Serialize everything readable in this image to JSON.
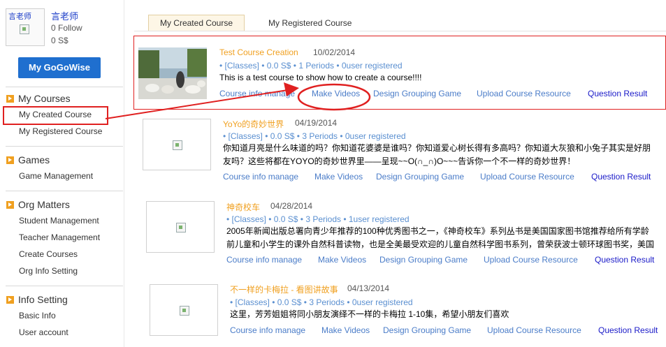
{
  "user": {
    "avatar_caption": "言老师",
    "name": "言老师",
    "follow": "0 Follow",
    "balance": "0 S$"
  },
  "gogowise_button": "My GoGoWise",
  "sidebar": {
    "sections": [
      {
        "title": "My Courses",
        "items": [
          "My Created Course",
          "My Registered Course"
        ]
      },
      {
        "title": "Games",
        "items": [
          "Game Management"
        ]
      },
      {
        "title": "Org Matters",
        "items": [
          "Student Management",
          "Teacher Management",
          "Create Courses",
          "Org Info Setting"
        ]
      },
      {
        "title": "Info Setting",
        "items": [
          "Basic Info",
          "User account"
        ]
      }
    ]
  },
  "tabs": [
    "My Created Course",
    "My Registered Course"
  ],
  "actions": [
    "Course info manage",
    "Make Videos",
    "Design Grouping Game",
    "Upload Course Resource",
    "Question Result"
  ],
  "courses": [
    {
      "title": "Test Course Creation",
      "date": "10/02/2014",
      "meta": "• [Classes] • 0.0 S$ • 1 Periods • 0user registered",
      "desc": [
        "This is a test course to show how to create a course!!!!"
      ]
    },
    {
      "title": "YoYo的奇妙世界",
      "date": "04/19/2014",
      "meta": "• [Classes] • 0.0 S$ • 3 Periods • 0user registered",
      "desc": [
        "你知道月亮是什么味道的吗？你知道花婆婆是谁吗？你知道爱心树长得有多高吗？你知道大灰狼和小兔子其实是好朋",
        "友吗？这些将都在YOYO的奇妙世界里——呈现~~O(∩_∩)O~~~告诉你一个不一样的奇妙世界！"
      ]
    },
    {
      "title": "神奇校车",
      "date": "04/28/2014",
      "meta": "• [Classes] • 0.0 S$ • 3 Periods • 1user registered",
      "desc": [
        "2005年新闻出版总署向青少年推荐的100种优秀图书之一，《神奇校车》系列丛书是美国国家图书馆推荐给所有学龄",
        "前儿童和小学生的课外自然科普读物，也是全美最受欢迎的儿童自然科学图书系列，曾荣获波士顿环球图书奖，美国"
      ]
    },
    {
      "title": "不一样的卡梅拉 - 看图讲故事",
      "date": "04/13/2014",
      "meta": "• [Classes] • 0.0 S$ • 3 Periods • 0user registered",
      "desc": [
        "这里，芳芳姐姐将同小朋友演绎不一样的卡梅拉 1-10集，希望小朋友们喜欢"
      ]
    }
  ],
  "colors": {
    "accent": "#1f6fcf",
    "highlight": "#e02020",
    "title": "#f0a020",
    "link": "#4a7cc8"
  }
}
